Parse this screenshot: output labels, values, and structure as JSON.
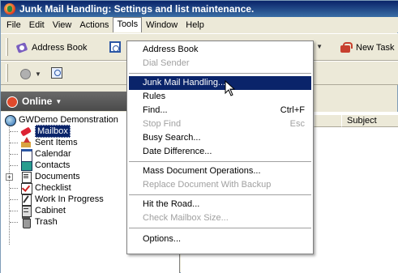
{
  "window": {
    "title": "Junk Mail Handling: Settings and list maintenance."
  },
  "menubar": {
    "items": [
      "File",
      "Edit",
      "View",
      "Actions",
      "Tools",
      "Window",
      "Help"
    ],
    "open": "Tools"
  },
  "toolbar": {
    "address_book": "Address Book",
    "new_task": "New Task",
    "partial_label": "t"
  },
  "online": {
    "label": "Online"
  },
  "tree": {
    "root": "GWDemo Demonstration",
    "items": [
      {
        "label": "Mailbox",
        "icon": "mailbox-icon",
        "selected": true
      },
      {
        "label": "Sent Items",
        "icon": "sent-items-icon"
      },
      {
        "label": "Calendar",
        "icon": "calendar-icon"
      },
      {
        "label": "Contacts",
        "icon": "contacts-icon"
      },
      {
        "label": "Documents",
        "icon": "documents-icon"
      },
      {
        "label": "Checklist",
        "icon": "checklist-icon"
      },
      {
        "label": "Work In Progress",
        "icon": "work-in-progress-icon"
      },
      {
        "label": "Cabinet",
        "icon": "cabinet-icon"
      },
      {
        "label": "Trash",
        "icon": "trash-icon"
      }
    ]
  },
  "list": {
    "column_subject": "Subject"
  },
  "tools_menu": {
    "items": [
      {
        "label": "Address Book",
        "enabled": true
      },
      {
        "label": "Dial Sender",
        "enabled": false
      },
      {
        "label": "Junk Mail Handling...",
        "enabled": true,
        "highlighted": true
      },
      {
        "label": "Rules",
        "enabled": true
      },
      {
        "label": "Find...",
        "enabled": true,
        "shortcut": "Ctrl+F"
      },
      {
        "label": "Stop Find",
        "enabled": false,
        "shortcut": "Esc"
      },
      {
        "label": "Busy Search...",
        "enabled": true
      },
      {
        "label": "Date Difference...",
        "enabled": true
      },
      {
        "label": "Mass Document Operations...",
        "enabled": true
      },
      {
        "label": "Replace Document With Backup",
        "enabled": false
      },
      {
        "label": "Hit the Road...",
        "enabled": true
      },
      {
        "label": "Check Mailbox Size...",
        "enabled": false
      },
      {
        "label": "Options...",
        "enabled": true
      }
    ]
  },
  "colors": {
    "title_bar": "#0a246a",
    "menu_highlight": "#0a246a",
    "disabled_text": "#a0a0a0"
  }
}
